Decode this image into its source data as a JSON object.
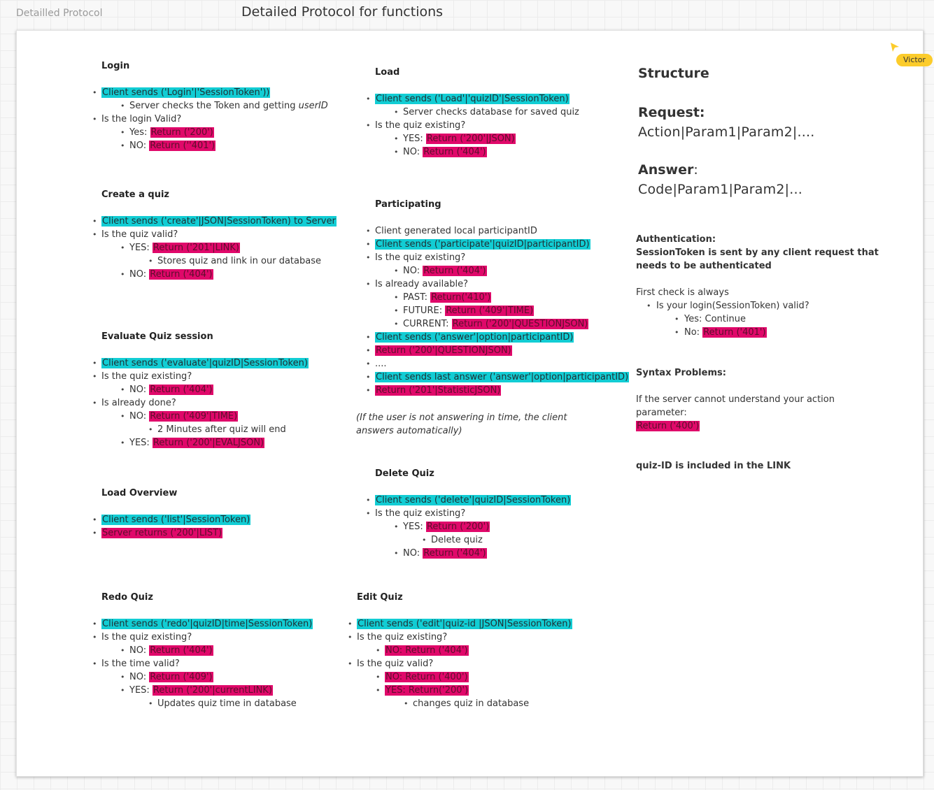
{
  "board": {
    "label": "Detailled Protocol",
    "title": "Detailed Protocol for functions"
  },
  "user": {
    "name": "Victor"
  },
  "login": {
    "title": "Login",
    "items": [
      {
        "lvl": 1,
        "hl": "c",
        "text": "Client sends ('Login'|'SessionToken'))"
      },
      {
        "lvl": 2,
        "pre": "Server checks the Token and getting ",
        "em": "userID"
      },
      {
        "lvl": 1,
        "pre": "Is the login Valid?"
      },
      {
        "lvl": 2,
        "pre": "Yes: ",
        "hl": "m",
        "text": "Return ('200')"
      },
      {
        "lvl": 2,
        "pre": "NO: ",
        "hl": "m",
        "text": "Return (''401')"
      }
    ]
  },
  "create": {
    "title": "Create a quiz",
    "items": [
      {
        "lvl": 1,
        "hl": "c",
        "text": "Client sends ('create'|JSON|SessionToken)  to Server"
      },
      {
        "lvl": 1,
        "pre": "Is the quiz valid?"
      },
      {
        "lvl": 2,
        "pre": "YES: ",
        "hl": "m",
        "text": "Return ('201'|LINK)"
      },
      {
        "lvl": 3,
        "pre": "Stores quiz and link in our database"
      },
      {
        "lvl": 2,
        "pre": "NO: ",
        "hl": "m",
        "text": "Return ('404')"
      }
    ]
  },
  "evaluate": {
    "title": "Evaluate Quiz session",
    "items": [
      {
        "lvl": 1,
        "hl": "c",
        "text": "Client sends ('evaluate'|quizID|SessionToken)"
      },
      {
        "lvl": 1,
        "pre": "Is the quiz existing?"
      },
      {
        "lvl": 2,
        "pre": "NO: ",
        "hl": "m",
        "text": "Return ('404')"
      },
      {
        "lvl": 1,
        "pre": "Is already done?"
      },
      {
        "lvl": 2,
        "pre": "NO: ",
        "hl": "m",
        "text": "Return ('409'|TIME)"
      },
      {
        "lvl": 3,
        "pre": "2 Minutes after quiz will end"
      },
      {
        "lvl": 2,
        "pre": "YES: ",
        "hl": "m",
        "text": "Return ('200'|EVALJSON)"
      }
    ]
  },
  "overview": {
    "title": "Load Overview",
    "items": [
      {
        "lvl": 1,
        "hl": "c",
        "text": "Client sends ('list'|SessionToken)"
      },
      {
        "lvl": 1,
        "hl": "m",
        "text": "Server returns ('200'|LIST)"
      }
    ]
  },
  "redo": {
    "title": "Redo Quiz",
    "items": [
      {
        "lvl": 1,
        "hl": "c",
        "text": "Client sends ('redo'|quizID|time|SessionToken)"
      },
      {
        "lvl": 1,
        "pre": "Is the quiz existing?"
      },
      {
        "lvl": 2,
        "pre": "NO: ",
        "hl": "m",
        "text": "Return ('404')"
      },
      {
        "lvl": 1,
        "pre": "Is the time valid?"
      },
      {
        "lvl": 2,
        "pre": "NO: ",
        "hl": "m",
        "text": "Return ('409')"
      },
      {
        "lvl": 2,
        "pre": "YES: ",
        "hl": "m",
        "text": "Return ('200'|currentLINK)"
      },
      {
        "lvl": 3,
        "pre": "Updates quiz time in database"
      }
    ]
  },
  "load": {
    "title": "Load",
    "items": [
      {
        "lvl": 1,
        "hl": "c",
        "text": "Client sends ('Load'|'quizID'|SessionToken)"
      },
      {
        "lvl": 2,
        "pre": "Server checks database for saved quiz"
      },
      {
        "lvl": 1,
        "pre": "Is the quiz existing?"
      },
      {
        "lvl": 2,
        "pre": "YES: ",
        "hl": "m",
        "text": "Return ('200'|JSON)"
      },
      {
        "lvl": 2,
        "pre": "NO: ",
        "hl": "m",
        "text": "Return ('404')"
      }
    ]
  },
  "participating": {
    "title": "Participating",
    "items": [
      {
        "lvl": 1,
        "pre": "Client generated local participantID"
      },
      {
        "lvl": 1,
        "hl": "c",
        "text": "Client sends ('participate'|quizID|participantID)"
      },
      {
        "lvl": 1,
        "pre": "Is the quiz existing?"
      },
      {
        "lvl": 2,
        "pre": "NO: ",
        "hl": "m",
        "text": "Return ('404')"
      },
      {
        "lvl": 1,
        "pre": "Is already available?"
      },
      {
        "lvl": 2,
        "pre": "PAST: ",
        "hl": "m",
        "text": "Return('410')"
      },
      {
        "lvl": 2,
        "pre": "FUTURE: ",
        "hl": "m",
        "text": "Return ('409'|TIME)"
      },
      {
        "lvl": 2,
        "pre": "CURRENT: ",
        "hl": "m",
        "text": "Return ('200'|QUESTIONJSON)"
      },
      {
        "lvl": 1,
        "hl": "c",
        "text": "Client sends ('answer'|option|participantID)"
      },
      {
        "lvl": 1,
        "hl": "m",
        "text": "Return ('200'|QUESTIONJSON)"
      },
      {
        "lvl": 1,
        "pre": "...."
      },
      {
        "lvl": 1,
        "hl": "c",
        "text": "Client sends last answer ('answer'|option|participantID)"
      },
      {
        "lvl": 1,
        "hl": "m",
        "text": "Return ('201'|StatisticJSON)"
      }
    ],
    "note": "(If the user is not answering in time, the client answers automatically)"
  },
  "delete": {
    "title": "Delete Quiz",
    "items": [
      {
        "lvl": 1,
        "hl": "c",
        "text": "Client sends ('delete'|quizID|SessionToken)"
      },
      {
        "lvl": 1,
        "pre": "Is the quiz existing?"
      },
      {
        "lvl": 2,
        "pre": "YES: ",
        "hl": "m",
        "text": "Return ('200')"
      },
      {
        "lvl": 3,
        "pre": "Delete quiz"
      },
      {
        "lvl": 2,
        "pre": "NO: ",
        "hl": "m",
        "text": "Return ('404')"
      }
    ]
  },
  "edit": {
    "title": "Edit Quiz",
    "items": [
      {
        "lvl": 1,
        "hl": "c",
        "text": "Client sends ('edit'|quiz-id  |JSON|SessionToken)"
      },
      {
        "lvl": 1,
        "pre": "Is the quiz existing?"
      },
      {
        "lvl": 2,
        "hl": "m",
        "text": "NO: Return ('404')"
      },
      {
        "lvl": 1,
        "pre": "Is the quiz valid?"
      },
      {
        "lvl": 2,
        "hl": "m",
        "text": "NO: Return ('400')"
      },
      {
        "lvl": 2,
        "hl": "m",
        "text": "YES: Return('200')"
      },
      {
        "lvl": 3,
        "pre": "changes quiz in database"
      }
    ]
  },
  "structure": {
    "title": "Structure",
    "request_label": "Request:",
    "request_format": "Action|Param1|Param2|....",
    "answer_label": "Answer",
    "answer_colon": ":",
    "answer_format": "Code|Param1|Param2|..."
  },
  "auth": {
    "title": "Authentication:",
    "desc_1": "SessionToken is sent by any client request that",
    "desc_2": "needs to be authenticated",
    "first": "First check is always",
    "check": "Is your login(SessionToken) valid?",
    "yes": "Yes: Continue",
    "no_pre": "No: ",
    "no_ret": "Return ('401')"
  },
  "syntax": {
    "title": "Syntax Problems:",
    "desc": "If the server cannot understand your action parameter:",
    "ret": "Return ('400')"
  },
  "quizid_note": "quiz-ID is included in the LINK",
  "colors": {
    "cyan": "#12cdd4",
    "magenta": "#e0086a",
    "user_badge": "#fccc2b"
  }
}
